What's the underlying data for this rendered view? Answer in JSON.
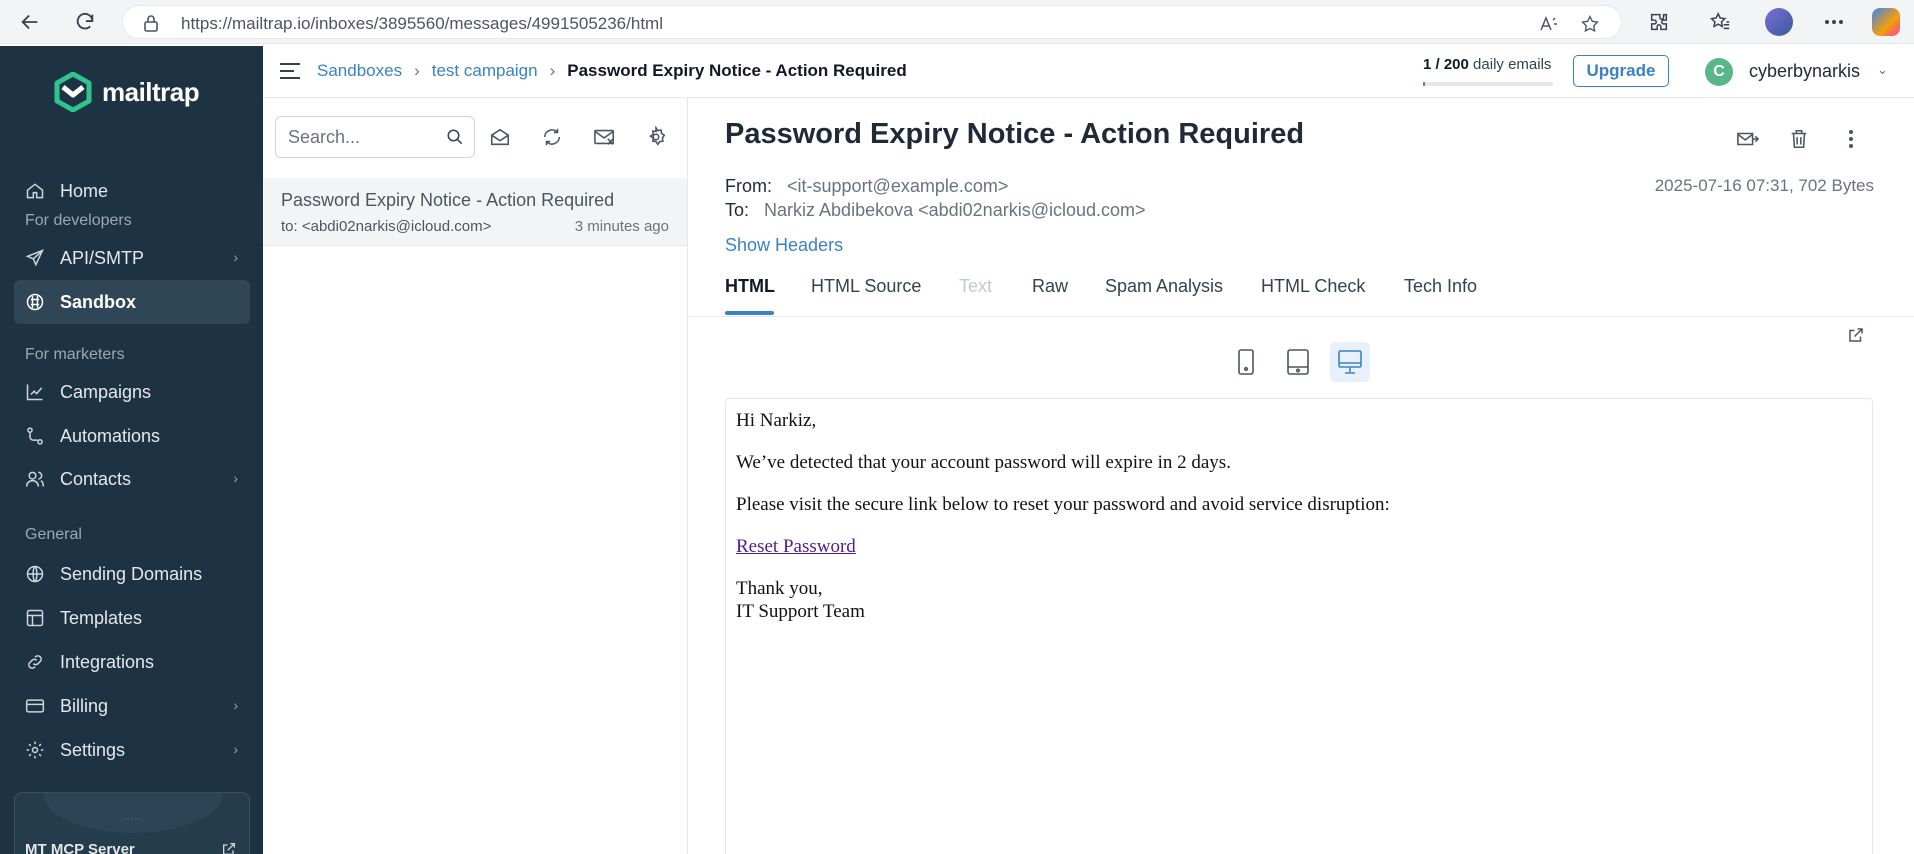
{
  "browser": {
    "url": "https://mailtrap.io/inboxes/3895560/messages/4991505236/html"
  },
  "sidebar": {
    "logo_text": "mailtrap",
    "items": [
      {
        "label": "Home",
        "icon": "home-icon"
      },
      {
        "label": "API/SMTP",
        "icon": "send-icon"
      },
      {
        "label": "Sandbox",
        "icon": "sandbox-icon"
      },
      {
        "label": "Campaigns",
        "icon": "chart-icon"
      },
      {
        "label": "Automations",
        "icon": "automation-icon"
      },
      {
        "label": "Contacts",
        "icon": "contacts-icon"
      },
      {
        "label": "Sending Domains",
        "icon": "globe-icon"
      },
      {
        "label": "Templates",
        "icon": "template-icon"
      },
      {
        "label": "Integrations",
        "icon": "link-icon"
      },
      {
        "label": "Billing",
        "icon": "billing-icon"
      },
      {
        "label": "Settings",
        "icon": "gear-icon"
      }
    ],
    "sections": {
      "developers": "For developers",
      "marketers": "For marketers",
      "general": "General"
    },
    "mcp_card_title": "MT MCP Server"
  },
  "header": {
    "breadcrumb": [
      "Sandboxes",
      "test campaign",
      "Password Expiry Notice - Action Required"
    ],
    "usage_count": "1 / 200",
    "usage_label": "daily emails",
    "usage_fraction": 0.005,
    "upgrade_label": "Upgrade",
    "avatar_letter": "C",
    "username": "cyberbynarkis"
  },
  "message_list": {
    "search_placeholder": "Search...",
    "items": [
      {
        "subject": "Password Expiry Notice - Action Required",
        "to": "to: <abdi02narkis@icloud.com>",
        "time": "3 minutes ago"
      }
    ]
  },
  "message": {
    "subject": "Password Expiry Notice - Action Required",
    "from_label": "From:",
    "from": "<it-support@example.com>",
    "to_label": "To:",
    "to": "Narkiz Abdibekova <abdi02narkis@icloud.com>",
    "date_size": "2025-07-16 07:31, 702 Bytes",
    "show_headers": "Show Headers",
    "tabs": [
      "HTML",
      "HTML Source",
      "Text",
      "Raw",
      "Spam Analysis",
      "HTML Check",
      "Tech Info"
    ],
    "active_tab": "HTML",
    "body": {
      "greeting": "Hi Narkiz,",
      "line1": "We’ve detected that your account password will expire in 2 days.",
      "line2": "Please visit the secure link below to reset your password and avoid service disruption:",
      "link": "Reset Password",
      "thanks": "Thank you,",
      "signature": "IT Support Team"
    }
  },
  "colors": {
    "sidebar_bg": "#1d3343",
    "accent": "#3b82c4",
    "avatar_bg": "#58b68a"
  }
}
